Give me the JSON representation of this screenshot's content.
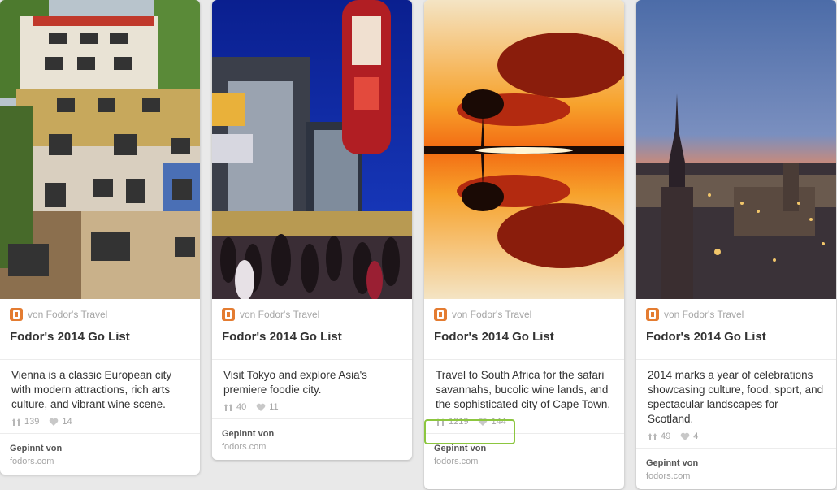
{
  "pins": [
    {
      "board_by": "von Fodor's Travel",
      "board_title": "Fodor's 2014 Go List",
      "description": "Vienna is a classic European city with modern attractions, rich arts culture, and vibrant wine scene.",
      "repins": "139",
      "likes": "14",
      "pinned_label": "Gepinnt von",
      "pinned_source": "fodors.com",
      "image_icon": "vienna-colorful-building-photo"
    },
    {
      "board_by": "von Fodor's Travel",
      "board_title": "Fodor's 2014 Go List",
      "description": "Visit Tokyo and explore Asia's premiere foodie city.",
      "repins": "40",
      "likes": "11",
      "pinned_label": "Gepinnt von",
      "pinned_source": "fodors.com",
      "image_icon": "tokyo-night-crossing-photo"
    },
    {
      "board_by": "von Fodor's Travel",
      "board_title": "Fodor's 2014 Go List",
      "description": "Travel to South Africa for the safari savannahs, bucolic wine lands, and the sophisticated city of Cape Town.",
      "repins": "1219",
      "likes": "144",
      "pinned_label": "Gepinnt von",
      "pinned_source": "fodors.com",
      "image_icon": "sunset-tree-reflection-photo"
    },
    {
      "board_by": "von Fodor's Travel",
      "board_title": "Fodor's 2014 Go List",
      "description": "2014 marks a year of celebrations showcasing culture, food, sport, and spectacular landscapes for Scotland.",
      "repins": "49",
      "likes": "4",
      "pinned_label": "Gepinnt von",
      "pinned_source": "fodors.com",
      "image_icon": "edinburgh-dusk-skyline-photo"
    }
  ],
  "colors": {
    "board_icon": "#e47c31",
    "highlight": "#8cc63f"
  }
}
